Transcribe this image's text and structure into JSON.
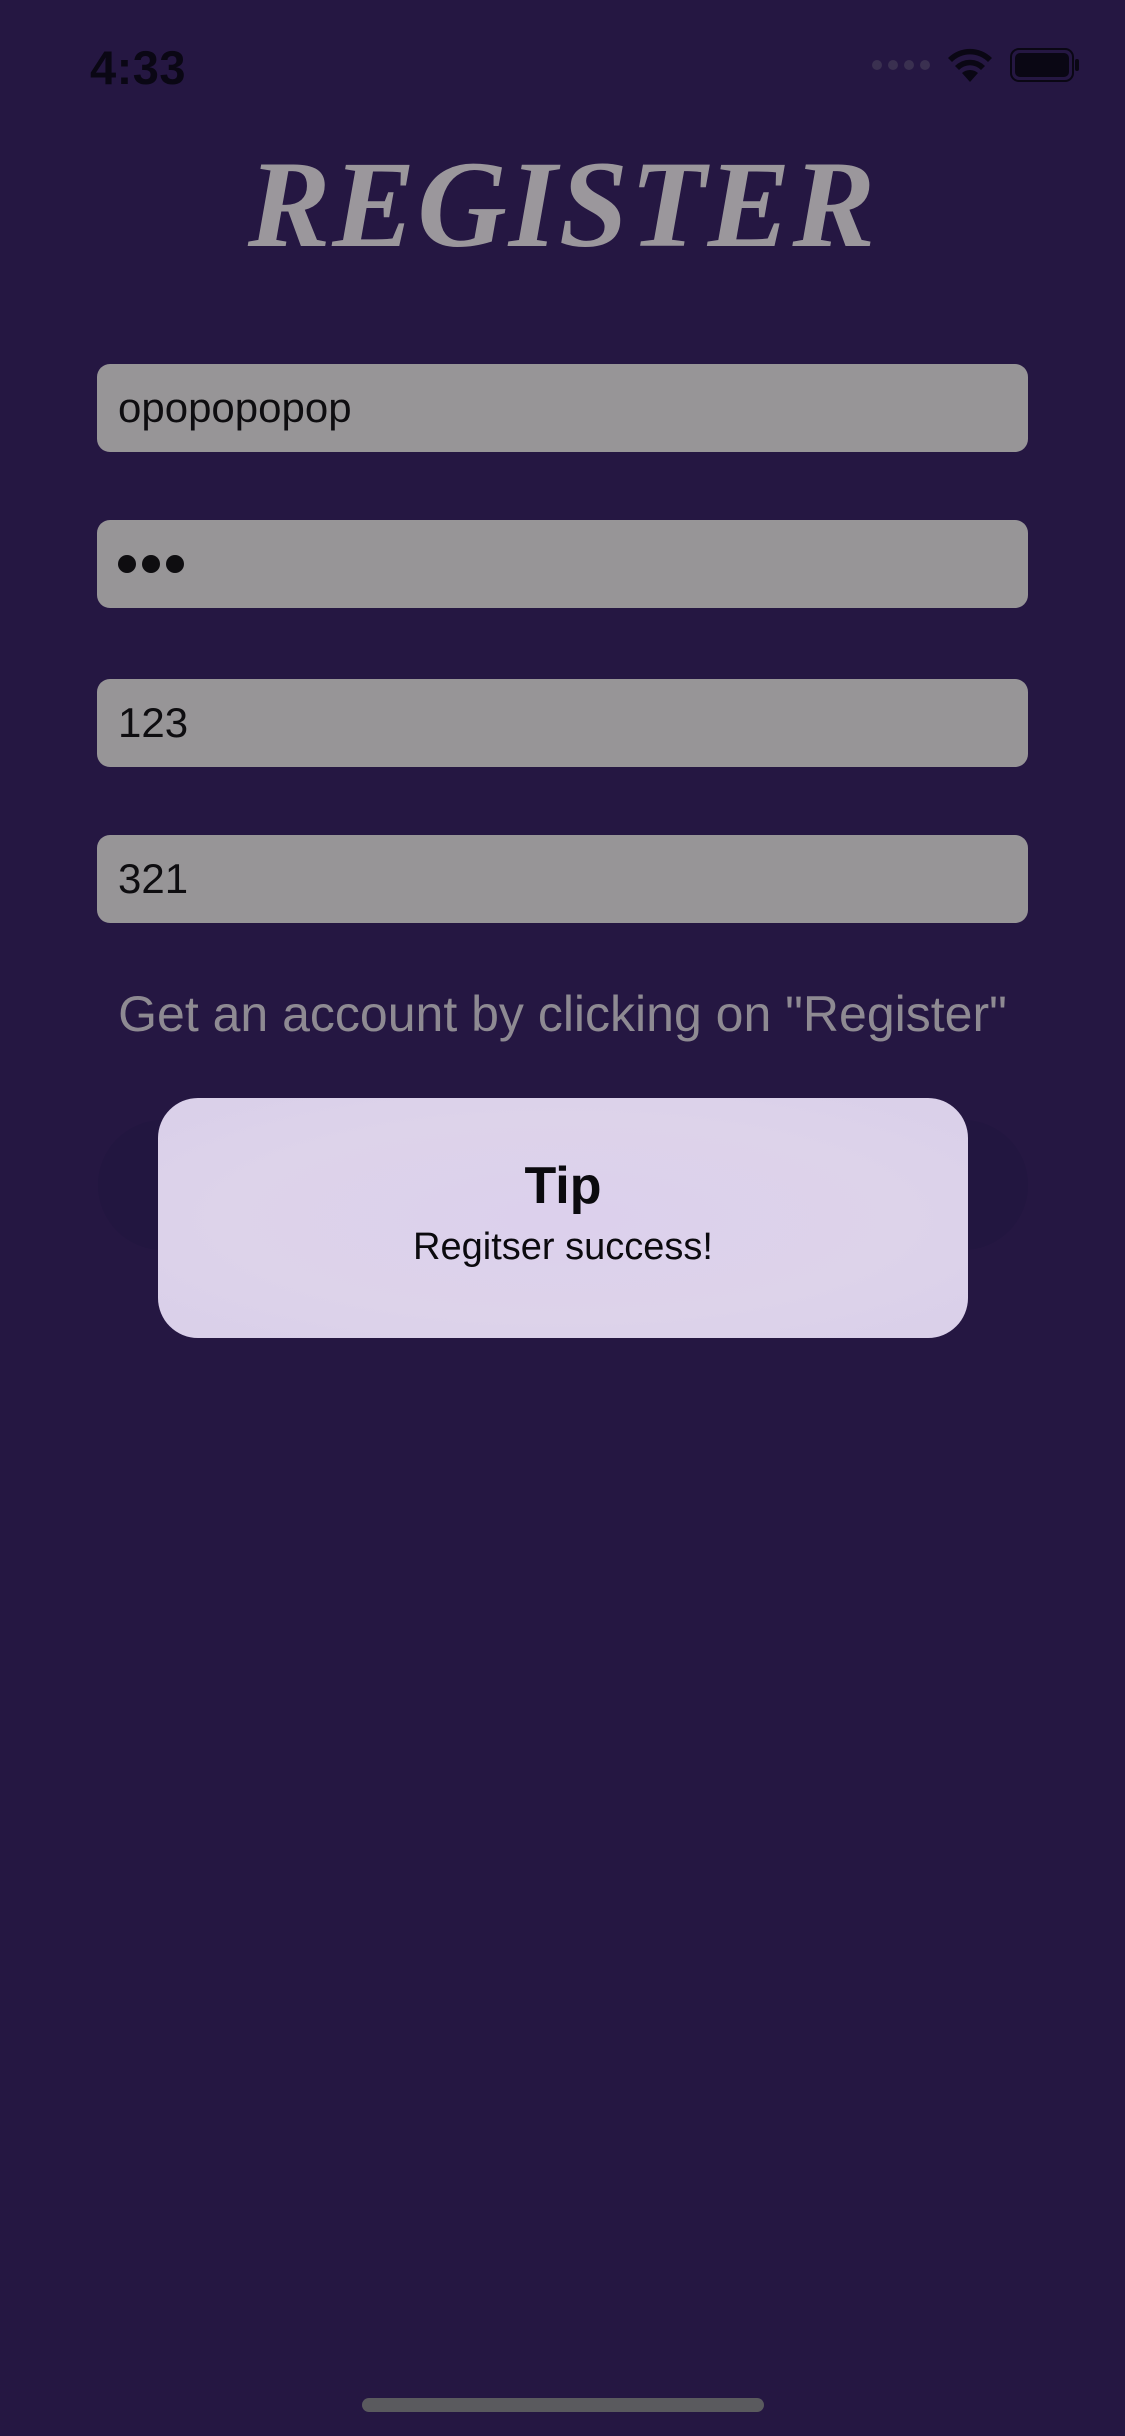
{
  "status_bar": {
    "time": "4:33"
  },
  "page": {
    "title": "REGISTER",
    "hint": "Get an account by clicking on \"Register\""
  },
  "form": {
    "username_value": "opopopopop",
    "password_masked": "•••",
    "field3_value": "123",
    "field4_value": "321"
  },
  "alert": {
    "title": "Tip",
    "message": "Regitser success!"
  },
  "colors": {
    "background": "#251742",
    "field": "#979597",
    "title": "#9b979c",
    "alert": "#dcd0ec"
  },
  "icons": [
    "signal-icon",
    "wifi-icon",
    "battery-icon"
  ]
}
